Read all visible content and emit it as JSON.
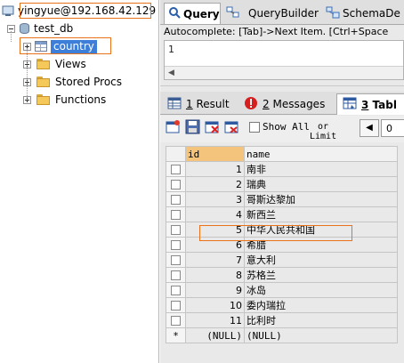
{
  "tree": {
    "connection": "yingyue@192.168.42.129",
    "database": "test_db",
    "table": "country",
    "folders": [
      "Views",
      "Stored Procs",
      "Functions"
    ]
  },
  "query_tabs": [
    {
      "label": "Query",
      "icon": "query-icon",
      "active": true
    },
    {
      "label": "QueryBuilder",
      "icon": "querybuilder-icon",
      "active": false
    },
    {
      "label": "SchemaDe",
      "icon": "schema-designer-icon",
      "active": false
    }
  ],
  "editor": {
    "autocomplete_hint": "Autocomplete: [Tab]->Next Item. [Ctrl+Space",
    "line_number": "1"
  },
  "result_tabs": [
    {
      "key": "1",
      "label": "Result",
      "icon": "result-grid-icon",
      "active": false
    },
    {
      "key": "2",
      "label": "Messages",
      "icon": "error-icon",
      "active": false
    },
    {
      "key": "3",
      "label": "Tabl",
      "icon": "table-data-icon",
      "active": true
    }
  ],
  "toolbar": {
    "show_all": "Show All",
    "or_limit_line1": "or",
    "or_limit_line2": "Limit",
    "limit_from": "0"
  },
  "grid": {
    "columns": [
      "id",
      "name"
    ],
    "rows": [
      {
        "id": "1",
        "name": "南非"
      },
      {
        "id": "2",
        "name": "瑞典"
      },
      {
        "id": "3",
        "name": "哥斯达黎加"
      },
      {
        "id": "4",
        "name": "新西兰"
      },
      {
        "id": "5",
        "name": "中华人民共和国"
      },
      {
        "id": "6",
        "name": "希腊"
      },
      {
        "id": "7",
        "name": "意大利"
      },
      {
        "id": "8",
        "name": "苏格兰"
      },
      {
        "id": "9",
        "name": "冰岛"
      },
      {
        "id": "10",
        "name": "委内瑞拉"
      },
      {
        "id": "11",
        "name": "比利时"
      }
    ],
    "new_row": {
      "marker": "*",
      "id": "(NULL)",
      "name": "(NULL)"
    }
  },
  "colors": {
    "highlight": "#e8731c",
    "id_header": "#f4c47c",
    "selected_tree_item": "#3d7fd8"
  }
}
